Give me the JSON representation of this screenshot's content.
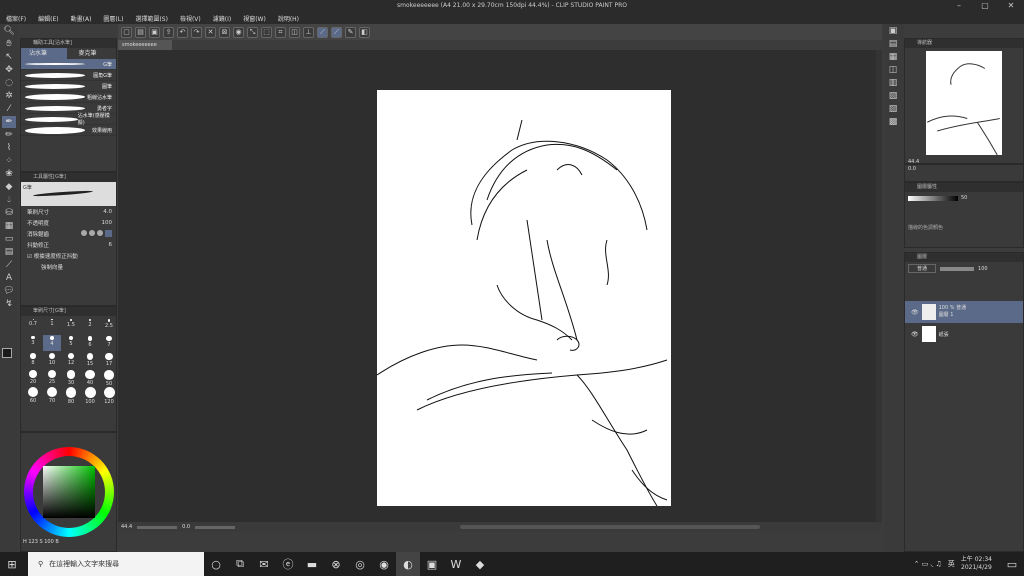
{
  "window": {
    "title": "smokeeeeeee (A4 21.00 x 29.70cm 150dpi 44.4%) - CLIP STUDIO PAINT PRO"
  },
  "menu": [
    "檔案(F)",
    "編輯(E)",
    "動畫(A)",
    "圖層(L)",
    "選擇範圍(S)",
    "檢視(V)",
    "濾鏡(I)",
    "視窗(W)",
    "說明(H)"
  ],
  "doc_tab": "smokeeeeeee",
  "subtool_panel": {
    "title": "輔助工具[沾水筆]",
    "tabs": [
      "沾水筆",
      "麥克筆"
    ],
    "brushes": [
      "G筆",
      "圓角G筆",
      "圓筆",
      "粗線沾水筆",
      "勇者字",
      "沾水筆(感壓模擬)",
      "效果線用"
    ]
  },
  "tool_property": {
    "title": "工具屬性[G筆]",
    "brush_preview_label": "G筆",
    "rows": [
      {
        "label": "筆刷尺寸",
        "value": "4.0"
      },
      {
        "label": "不透明度",
        "value": "100"
      },
      {
        "label": "消除鋸齒",
        "value": ""
      },
      {
        "label": "抖動修正",
        "value": "6"
      }
    ],
    "checkbox_label": "根據速度修正抖動",
    "input_label": "強制向量"
  },
  "brush_size": {
    "title": "筆刷尺寸[G筆]",
    "values": [
      "0.7",
      "1",
      "1.5",
      "2",
      "2.5",
      "3",
      "4",
      "5",
      "6",
      "7",
      "8",
      "10",
      "12",
      "15",
      "17",
      "20",
      "25",
      "30",
      "40",
      "50",
      "60",
      "70",
      "80",
      "100",
      "120"
    ],
    "selected": "4"
  },
  "color": {
    "wheel_footer": "H 123 S 100 B",
    "main_color": "#1a1a1a",
    "sub_color": "#ffffff",
    "accent": "#5b6a88"
  },
  "status": {
    "zoom": "44.4",
    "rot": "0.0"
  },
  "navigator": {
    "title": "導航器",
    "zoom": "44.4",
    "angle": "0.0"
  },
  "layer_property": {
    "title": "圖層屬性",
    "value": "50",
    "label": "描線的色調顏色"
  },
  "layers_panel": {
    "title": "圖層",
    "blend": "普通",
    "opacity": "100",
    "layers": [
      {
        "name": "100 % 普通",
        "sub": "圖層 1",
        "selected": true
      },
      {
        "name": "紙張",
        "sub": "",
        "selected": false
      }
    ]
  },
  "taskbar": {
    "search_placeholder": "在這裡輸入文字來搜尋",
    "time": "上午 02:34",
    "date": "2021/4/29",
    "lang": "英"
  }
}
